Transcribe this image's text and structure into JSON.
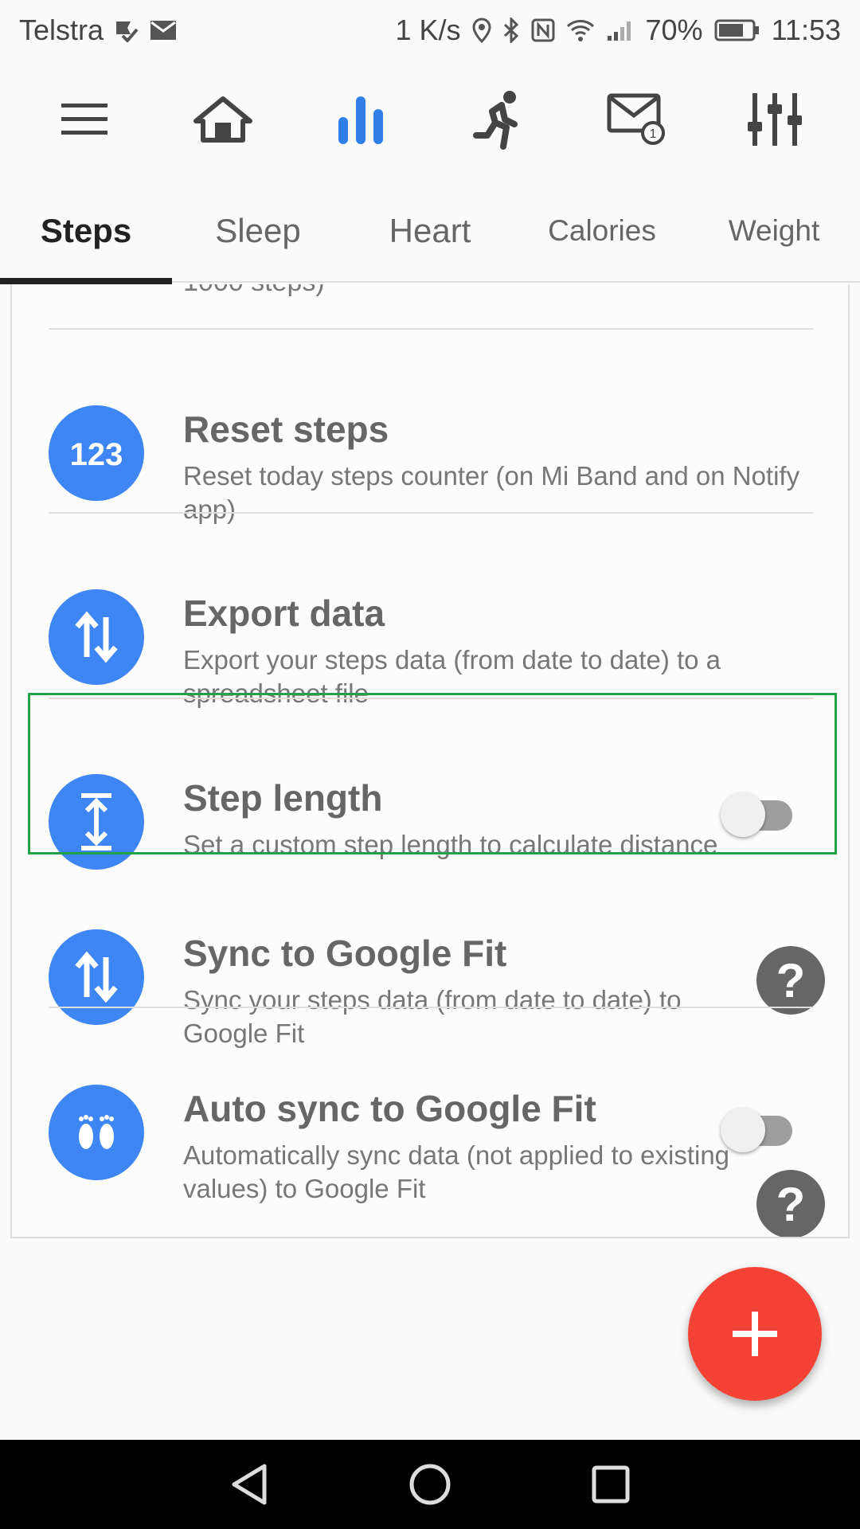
{
  "status_bar": {
    "carrier": "Telstra",
    "net_speed": "1 K/s",
    "battery": "70%",
    "time": "11:53",
    "icons": [
      "notification-check-icon",
      "mail-icon",
      "location-icon",
      "bluetooth-icon",
      "nfc-icon",
      "wifi-icon",
      "signal-icon",
      "battery-icon"
    ]
  },
  "top_nav": {
    "icons": [
      "menu-icon",
      "home-icon",
      "stats-icon",
      "workout-icon",
      "notifications-icon",
      "settings-icon"
    ],
    "active": "stats-icon",
    "active_color": "#2f7fe6"
  },
  "tabs": [
    {
      "label": "Steps",
      "active": true
    },
    {
      "label": "Sleep",
      "active": false
    },
    {
      "label": "Heart",
      "active": false
    },
    {
      "label": "Calories",
      "active": false
    },
    {
      "label": "Weight",
      "active": false
    }
  ],
  "list": {
    "clipped_text": "1000 steps)",
    "items": [
      {
        "title": "Reset steps",
        "desc": "Reset today steps counter (on Mi Band and on Notify app)",
        "icon": "123-icon"
      },
      {
        "title": "Export data",
        "desc": "Export your steps data (from date to date) to a spreadsheet file",
        "icon": "swap-vertical-icon"
      },
      {
        "title": "Step length",
        "desc": "Set a custom step length to calculate distance",
        "icon": "height-icon",
        "toggle_on": false
      },
      {
        "title": "Sync to Google Fit",
        "desc": "Sync your steps data (from date to date) to Google Fit",
        "icon": "swap-vertical-icon",
        "help": "?"
      },
      {
        "title": "Auto sync to Google Fit",
        "desc": "Automatically sync data (not applied to existing values) to Google Fit",
        "icon": "footprints-icon",
        "toggle_on": false,
        "help": "?"
      }
    ]
  },
  "colors": {
    "accent_blue": "#3d86f4",
    "fab_red": "#f44336",
    "highlight_green": "#22a34a"
  },
  "fab": {
    "icon": "plus-icon"
  },
  "android_nav": {
    "icons": [
      "back-icon",
      "home-circle-icon",
      "recents-icon"
    ]
  }
}
